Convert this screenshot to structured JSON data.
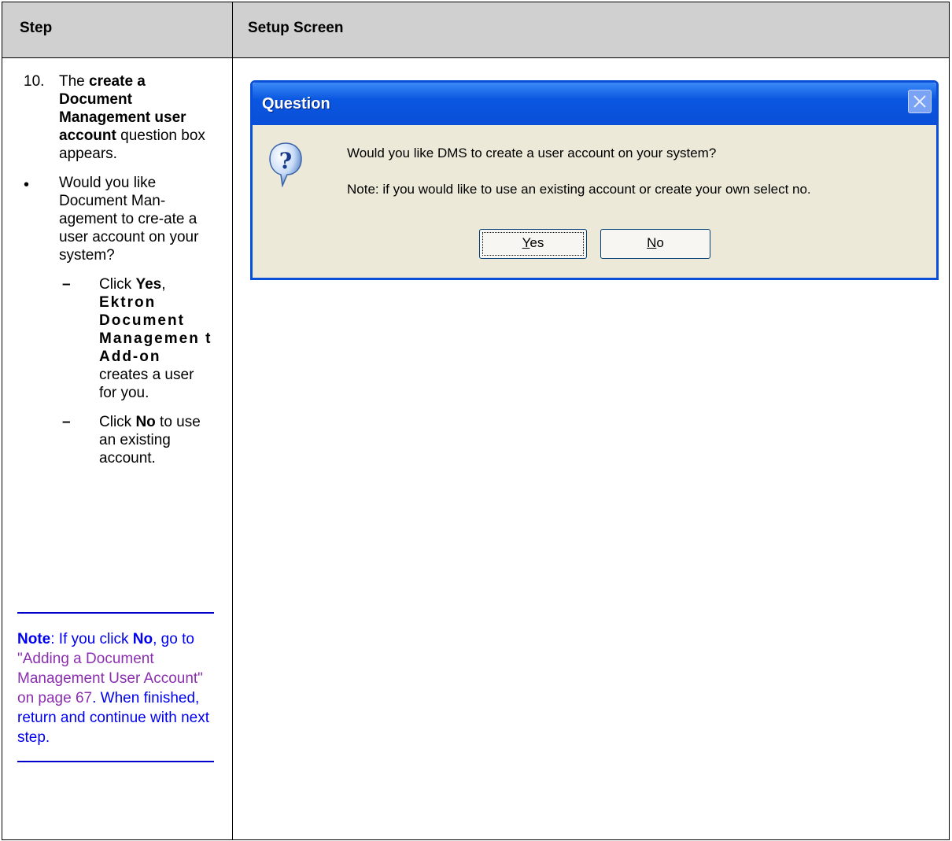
{
  "header": {
    "step": "Step",
    "setup_screen": "Setup Screen"
  },
  "step": {
    "number": "10.",
    "intro_pre": "The ",
    "intro_bold": "create a Document Management user account",
    "intro_post": " question box appears.",
    "bullet_symbol": "•",
    "bullet_text": "Would you like Document Man-agement to cre-ate a user account on your system?",
    "yes_item": {
      "dash": "–",
      "pre": "Click ",
      "bold": "Yes",
      "post": ",",
      "product": "Ektron Document Managemen t Add-on",
      "tail": "creates a user for you."
    },
    "no_item": {
      "dash": "–",
      "pre": "Click ",
      "bold": "No",
      "post": " to use an existing account."
    }
  },
  "note": {
    "label": "Note",
    "pre": ": If you click ",
    "no": "No",
    "comma": ",",
    "go_to": " go to ",
    "link": "\"Adding a Document Management User Account\" on page 67",
    "tail": ". When finished, return and continue with next step."
  },
  "dialog": {
    "title": "Question",
    "message_1": "Would you like DMS to create a user account on your system?",
    "message_2": "Note: if you would like to use an existing account or create your own select no.",
    "yes_mnemonic": "Y",
    "yes_rest": "es",
    "no_mnemonic": "N",
    "no_rest": "o"
  },
  "colors": {
    "header_bg": "#d0d0d0",
    "note_blue": "#0000ee",
    "link_purple": "#8b2fb0",
    "xp_blue": "#0a4fd8",
    "dialog_bg": "#ece9d8"
  }
}
